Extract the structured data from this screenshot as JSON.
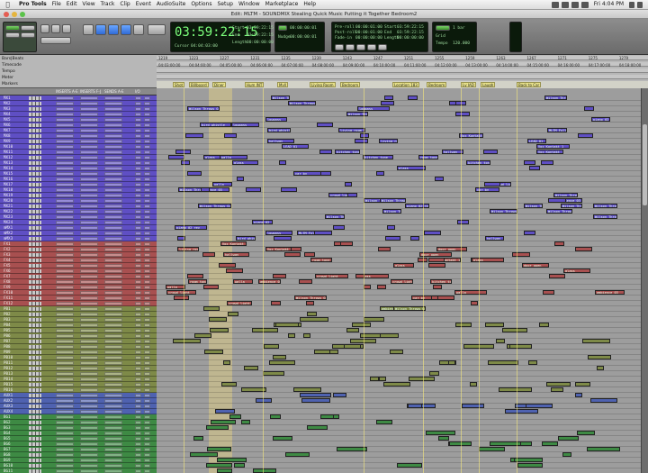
{
  "menubar": {
    "app": "Pro Tools",
    "items": [
      "File",
      "Edit",
      "View",
      "Track",
      "Clip",
      "Event",
      "AudioSuite",
      "Options",
      "Setup",
      "Window",
      "Marketplace",
      "Help"
    ],
    "clock": "Fri 4:04 PM"
  },
  "window": {
    "title": "Edit: MLTM - SOUNDMIX Stealing Quick Music Putting it Together Bedroom2"
  },
  "toolbar": {
    "main_counter": "03:59:22:15",
    "cursor_label": "Cursor",
    "cursor_value": "04:04:03:00",
    "start_label": "Start",
    "end_label": "End",
    "length_label": "Length",
    "start_value": "03:59:22:15",
    "end_value": "03:59:22:15",
    "length_value": "00:00:00:00",
    "nudge_label": "Nudge",
    "nudge_value": "00:00:00:01",
    "preroll_label": "Pre-roll",
    "postroll_label": "Post-roll",
    "fadein_label": "Fade-in",
    "preroll_value": "00:00:01:00",
    "postroll_value": "00:00:01:00",
    "fadein_value": "00:00:00:00",
    "t_start_label": "Start",
    "t_end_label": "End",
    "t_length_label": "Length",
    "t_start_value": "03:59:22:15",
    "t_end_value": "03:59:22:15",
    "t_length_value": "00:00:00:00",
    "grid_label": "Grid",
    "grid_value": "1 bar",
    "tempo_label": "Tempo",
    "tempo_value": "120.000"
  },
  "ruler": {
    "labels": [
      "Bars|Beats",
      "Timecode",
      "Tempo",
      "Meter",
      "Markers"
    ],
    "bar_ticks": [
      "1219",
      "1223",
      "1227",
      "1231",
      "1235",
      "1239",
      "1243",
      "1247",
      "1251",
      "1255",
      "1259",
      "1263",
      "1267",
      "1271",
      "1275",
      "1279"
    ],
    "tc_ticks": [
      "04:03:00:00",
      "04:04:00:00",
      "04:05:00:00",
      "04:06:00:00",
      "04:07:00:00",
      "04:08:00:00",
      "04:09:00:00",
      "04:10:00:00",
      "04:11:00:00",
      "04:12:00:00",
      "04:13:00:00",
      "04:14:00:00",
      "04:15:00:00",
      "04:16:00:00",
      "04:17:00:00",
      "04:18:00:00"
    ],
    "markers": [
      "Shot",
      "Billboard",
      "Diner",
      "Hum INT",
      "Myll",
      "Living Room",
      "Bedroom",
      "Location 183",
      "Bedroom",
      "Lv IAD",
      "Laugh",
      "Back to Car"
    ]
  },
  "headers": {
    "insert_a": "INSERTS A-E",
    "insert_f": "INSERTS F-J",
    "sends": "SENDS A-E",
    "io": "I/O"
  },
  "tracks": [
    {
      "name": "MX1",
      "color": "#5f4fc4"
    },
    {
      "name": "MX2",
      "color": "#5f4fc4"
    },
    {
      "name": "MX3",
      "color": "#5f4fc4"
    },
    {
      "name": "MX4",
      "color": "#5f4fc4"
    },
    {
      "name": "MX5",
      "color": "#5f4fc4"
    },
    {
      "name": "MX6",
      "color": "#5f4fc4"
    },
    {
      "name": "MX7",
      "color": "#5f4fc4"
    },
    {
      "name": "MX8",
      "color": "#5f4fc4"
    },
    {
      "name": "MX9",
      "color": "#5f4fc4"
    },
    {
      "name": "MX10",
      "color": "#5f4fc4"
    },
    {
      "name": "MX11",
      "color": "#5f4fc4"
    },
    {
      "name": "MX12",
      "color": "#5f4fc4"
    },
    {
      "name": "MX13",
      "color": "#5f4fc4"
    },
    {
      "name": "MX14",
      "color": "#5f4fc4"
    },
    {
      "name": "MX15",
      "color": "#5f4fc4"
    },
    {
      "name": "MX16",
      "color": "#5f4fc4"
    },
    {
      "name": "MX17",
      "color": "#5f4fc4"
    },
    {
      "name": "MX18",
      "color": "#5f4fc4"
    },
    {
      "name": "MX19",
      "color": "#5f4fc4"
    },
    {
      "name": "MX20",
      "color": "#5f4fc4"
    },
    {
      "name": "MX21",
      "color": "#5f4fc4"
    },
    {
      "name": "MX22",
      "color": "#5f4fc4"
    },
    {
      "name": "MX23",
      "color": "#5f4fc4"
    },
    {
      "name": "MX24",
      "color": "#5f4fc4"
    },
    {
      "name": "mMX1",
      "color": "#5f4fc4"
    },
    {
      "name": "mMX2",
      "color": "#5f4fc4"
    },
    {
      "name": "mMX3",
      "color": "#5f4fc4"
    },
    {
      "name": "FX1",
      "color": "#a85050"
    },
    {
      "name": "FX2",
      "color": "#a85050"
    },
    {
      "name": "FX3",
      "color": "#a85050"
    },
    {
      "name": "FX4",
      "color": "#a85050"
    },
    {
      "name": "FX5",
      "color": "#a85050"
    },
    {
      "name": "FX6",
      "color": "#a85050"
    },
    {
      "name": "FX7",
      "color": "#a85050"
    },
    {
      "name": "FX8",
      "color": "#a85050"
    },
    {
      "name": "FX9",
      "color": "#a85050"
    },
    {
      "name": "FX10",
      "color": "#a85050"
    },
    {
      "name": "FX11",
      "color": "#a85050"
    },
    {
      "name": "FX12",
      "color": "#a85050"
    },
    {
      "name": "PB1",
      "color": "#7e8a48"
    },
    {
      "name": "PB2",
      "color": "#7e8a48"
    },
    {
      "name": "PB3",
      "color": "#7e8a48"
    },
    {
      "name": "PB4",
      "color": "#7e8a48"
    },
    {
      "name": "PB5",
      "color": "#7e8a48"
    },
    {
      "name": "PB6",
      "color": "#7e8a48"
    },
    {
      "name": "PB7",
      "color": "#7e8a48"
    },
    {
      "name": "PB8",
      "color": "#7e8a48"
    },
    {
      "name": "PB9",
      "color": "#7e8a48"
    },
    {
      "name": "PB10",
      "color": "#7e8a48"
    },
    {
      "name": "PB11",
      "color": "#7e8a48"
    },
    {
      "name": "PB12",
      "color": "#7e8a48"
    },
    {
      "name": "PB13",
      "color": "#7e8a48"
    },
    {
      "name": "PB14",
      "color": "#7e8a48"
    },
    {
      "name": "PB15",
      "color": "#7e8a48"
    },
    {
      "name": "PB16",
      "color": "#7e8a48"
    },
    {
      "name": "AUX1",
      "color": "#4f62b0"
    },
    {
      "name": "AUX2",
      "color": "#4f62b0"
    },
    {
      "name": "AUX3",
      "color": "#4f62b0"
    },
    {
      "name": "AUX4",
      "color": "#4f62b0"
    },
    {
      "name": "BG1",
      "color": "#3e8a44"
    },
    {
      "name": "BG2",
      "color": "#3e8a44"
    },
    {
      "name": "BG3",
      "color": "#3e8a44"
    },
    {
      "name": "BG4",
      "color": "#3e8a44"
    },
    {
      "name": "BG5",
      "color": "#3e8a44"
    },
    {
      "name": "BG6",
      "color": "#3e8a44"
    },
    {
      "name": "BG7",
      "color": "#3e8a44"
    },
    {
      "name": "BG8",
      "color": "#3e8a44"
    },
    {
      "name": "BG9",
      "color": "#3e8a44"
    },
    {
      "name": "BG10",
      "color": "#3e8a44"
    },
    {
      "name": "BG11",
      "color": "#3e8a44"
    },
    {
      "name": "BG12",
      "color": "#3e8a44"
    }
  ],
  "clip_labels": [
    "Wilson Throws Guys BASS STEM",
    "Wilson Throws Guys DRUMS STEM",
    "Wilson Throws Guys MUSIC STEM",
    "Wilson Throws Guys VOX STEM",
    "piano 02 rev",
    "lowpass",
    "MLTM Full Score",
    "bird whistle",
    "living room",
    "LEAD 01",
    "Vox Kontakt 1",
    "hallway",
    "door open",
    "glass",
    "kitchen tone",
    "room tone 01",
    "walla",
    "car by",
    "crowd light",
    "ambience 03"
  ]
}
